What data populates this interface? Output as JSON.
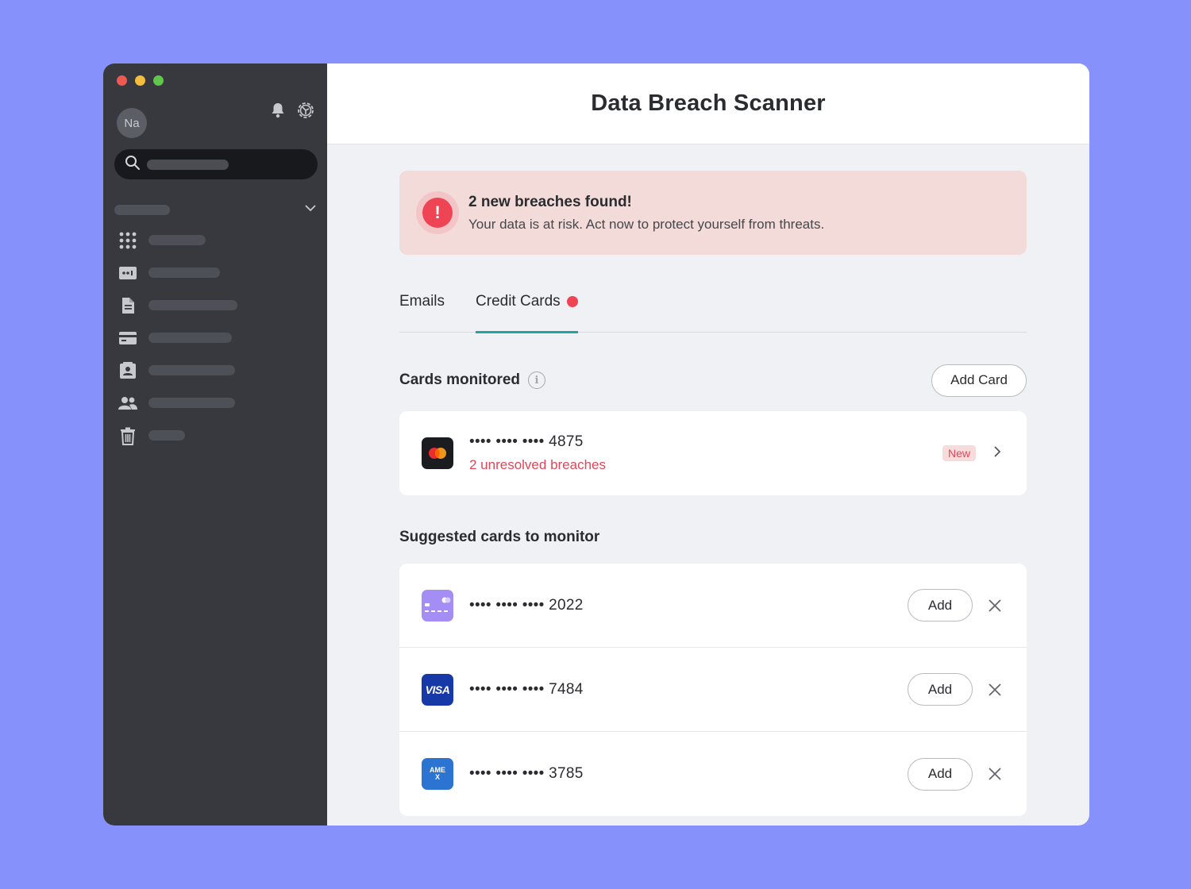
{
  "sidebar": {
    "avatar_initials": "Na",
    "icons": [
      "bell-icon",
      "gear-icon",
      "search-icon",
      "chevron-down-icon",
      "grid-icon",
      "id-card-icon",
      "document-icon",
      "credit-card-icon",
      "contact-icon",
      "users-icon",
      "trash-icon"
    ]
  },
  "header": {
    "title": "Data Breach Scanner"
  },
  "alert": {
    "icon": "!",
    "title": "2 new breaches found!",
    "text": "Your data is at risk. Act now to protect yourself from threats."
  },
  "tabs": [
    {
      "label": "Emails"
    },
    {
      "label": "Credit Cards"
    }
  ],
  "monitored": {
    "title": "Cards monitored",
    "add_label": "Add Card",
    "cards": [
      {
        "number": "•••• •••• •••• 4875",
        "status": "2 unresolved breaches",
        "badge": "New",
        "brand": "mastercard"
      }
    ]
  },
  "suggested": {
    "title": "Suggested cards to monitor",
    "cards": [
      {
        "number": "•••• •••• •••• 2022",
        "action": "Add",
        "brand": "generic"
      },
      {
        "number": "•••• •••• •••• 7484",
        "action": "Add",
        "brand": "visa",
        "logo_text": "VISA"
      },
      {
        "number": "•••• •••• •••• 3785",
        "action": "Add",
        "brand": "amex",
        "logo_text": "AMEX"
      }
    ]
  },
  "colors": {
    "accent": "#1ea59c",
    "danger": "#ee4454",
    "background": "#8691fb",
    "sidebar": "#37393e"
  }
}
